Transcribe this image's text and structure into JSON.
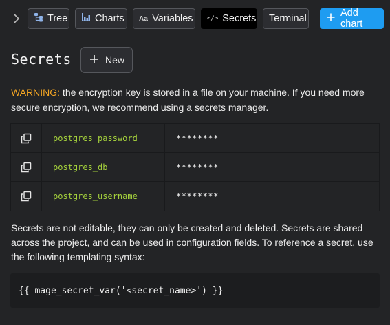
{
  "toolbar": {
    "tree_label": "Tree",
    "charts_label": "Charts",
    "variables_label": "Variables",
    "variables_icon_text": "Aa",
    "secrets_label": "Secrets",
    "secrets_icon_text": "</>",
    "terminal_label": "Terminal",
    "add_chart_label": "Add chart",
    "active_tab": "Secrets"
  },
  "header": {
    "title": "Secrets",
    "new_label": "New"
  },
  "warning": {
    "label": "WARNING:",
    "text": " the encryption key is stored in a file on your machine. If you need more secure encryption, we recommend using a secrets manager."
  },
  "secrets": [
    {
      "name": "postgres_password",
      "value": "********"
    },
    {
      "name": "postgres_db",
      "value": "********"
    },
    {
      "name": "postgres_username",
      "value": "********"
    }
  ],
  "description": "Secrets are not editable, they can only be created and deleted. Secrets are shared across the project, and can be used in configuration fields. To reference a secret, use the following templating syntax:",
  "template_syntax": "{{ mage_secret_var('<secret_name>') }}",
  "colors": {
    "background": "#232426",
    "accent": "#1e9cf1",
    "warning": "#f5a623",
    "secret_name": "#a5d23c"
  },
  "icons": {
    "collapse": "chevron-right-icon",
    "tree": "tree-icon",
    "charts": "bar-chart-icon",
    "variables": "text-aa-icon",
    "secrets": "code-icon",
    "add": "plus-icon",
    "copy": "copy-icon"
  }
}
